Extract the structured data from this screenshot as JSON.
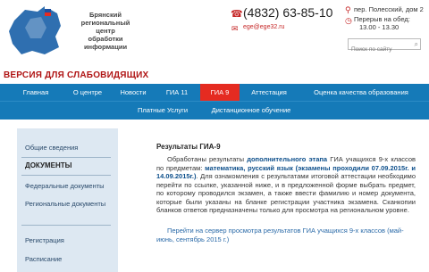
{
  "header": {
    "org_lines": [
      "Брянский",
      "региональный",
      "центр",
      "обработки",
      "информации"
    ],
    "vision_link": "ВЕРСИЯ ДЛЯ СЛАБОВИДЯЩИХ",
    "phone": "(4832) 63-85-10",
    "email": "ege@ege32.ru",
    "address": "пер. Полесский, дом 2",
    "lunch_label": "Перерыв на обед:",
    "lunch_hours": "13.00 - 13.30",
    "search_placeholder": "Поиск по сайту",
    "brand_red": "#e52b21",
    "brand_blue": "#157ab8"
  },
  "nav": {
    "row1": [
      "Главная",
      "О центре",
      "Новости",
      "ГИА 11",
      "ГИА 9",
      "Аттестация",
      "Оценка качества образования"
    ],
    "row2": [
      "Платные Услуги",
      "Дистанционное обучение"
    ],
    "active": "ГИА 9"
  },
  "sidebar": {
    "items": [
      "Общие сведения",
      "ДОКУМЕНТЫ",
      "Федеральные документы",
      "Региональные документы",
      "Регистрация",
      "Расписание"
    ],
    "current": "ДОКУМЕНТЫ"
  },
  "content": {
    "title": "Результаты ГИА-9",
    "p1_a": "Обработаны результаты ",
    "p1_b": "дополнительного этапа",
    "p1_c": " ГИА учащихся 9-х классов по предметам: ",
    "p1_d": "математика, русский язык (экзамены проходили 07.09.2015г. и 14.09.2015г.)",
    "p1_e": ". Для ознакомления с результатами итоговой аттестации необходимо перейти по ссылке, указанной ниже, и в предложенной форме выбрать предмет, по которому проводился экзамен, а также ввести фамилию и номер документа, которые были указаны на бланке регистрации участника экзамена. Сканкопии бланков ответов предназначены только для просмотра на региональном уровне.",
    "results_link": "Перейти на сервер просмотра результатов ГИА учащихся 9-х классов (май-июнь, сентябрь 2015 г.)"
  }
}
